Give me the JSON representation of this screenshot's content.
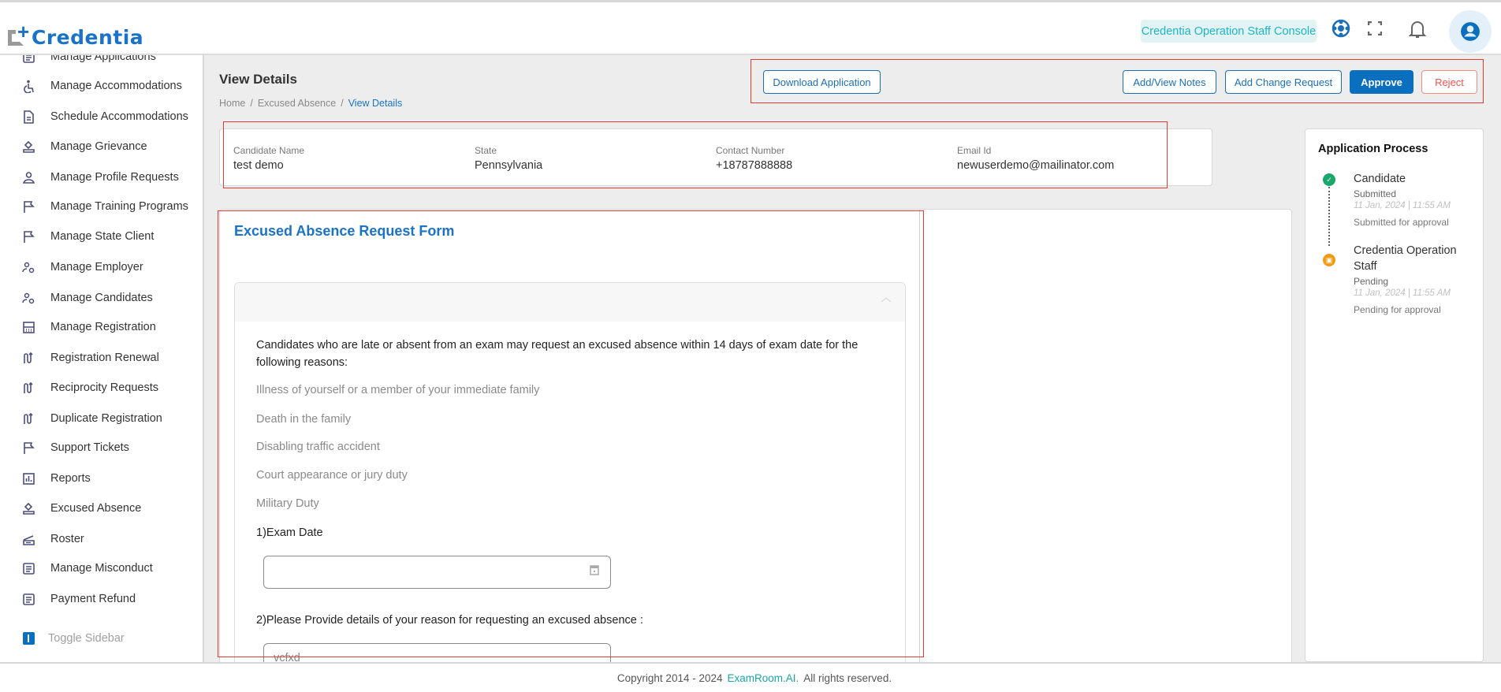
{
  "header": {
    "logo_text": "Credentia",
    "console_badge": "Credentia Operation Staff Console",
    "icons": [
      "support-icon",
      "fullscreen-icon",
      "bell-icon",
      "account-icon"
    ]
  },
  "sidebar": {
    "items": [
      {
        "label": "Manage Applications",
        "icon": "document-icon"
      },
      {
        "label": "Manage Accommodations",
        "icon": "accessible-icon"
      },
      {
        "label": "Schedule Accommodations",
        "icon": "file-icon"
      },
      {
        "label": "Manage Grievance",
        "icon": "stamp-icon"
      },
      {
        "label": "Manage Profile Requests",
        "icon": "person-icon"
      },
      {
        "label": "Manage Training Programs",
        "icon": "flag-icon"
      },
      {
        "label": "Manage State Client",
        "icon": "flag-icon"
      },
      {
        "label": "Manage Employer",
        "icon": "people-gear-icon"
      },
      {
        "label": "Manage Candidates",
        "icon": "people-gear-icon"
      },
      {
        "label": "Manage Registration",
        "icon": "grid-icon"
      },
      {
        "label": "Registration Renewal",
        "icon": "renew-icon"
      },
      {
        "label": "Reciprocity Requests",
        "icon": "renew-icon"
      },
      {
        "label": "Duplicate Registration",
        "icon": "renew-icon"
      },
      {
        "label": "Support Tickets",
        "icon": "flag-icon"
      },
      {
        "label": "Reports",
        "icon": "chart-icon"
      },
      {
        "label": "Excused Absence",
        "icon": "stamp-icon"
      },
      {
        "label": "Roster",
        "icon": "roster-icon"
      },
      {
        "label": "Manage Misconduct",
        "icon": "document-icon"
      },
      {
        "label": "Payment Refund",
        "icon": "document-icon"
      }
    ],
    "toggle_label": "Toggle Sidebar"
  },
  "page": {
    "title": "View Details",
    "breadcrumb": [
      "Home",
      "Excused Absence",
      "View Details"
    ],
    "separator": "/"
  },
  "actions": {
    "download": "Download Application",
    "notes": "Add/View Notes",
    "change_request": "Add Change Request",
    "approve": "Approve",
    "reject": "Reject"
  },
  "candidate": [
    {
      "label": "Candidate Name",
      "value": "test demo"
    },
    {
      "label": "State",
      "value": "Pennsylvania"
    },
    {
      "label": "Contact Number",
      "value": "+18787888888"
    },
    {
      "label": "Email Id",
      "value": "newuserdemo@mailinator.com"
    }
  ],
  "form": {
    "title": "Excused Absence Request Form",
    "intro": "Candidates who are late or absent from an exam may request an excused absence within 14 days of exam date for the following reasons:",
    "reasons": [
      "Illness of yourself or a member of your immediate family",
      "Death in the family",
      "Disabling traffic accident",
      "Court appearance or jury duty",
      "Military Duty"
    ],
    "q1": "1)Exam Date",
    "q1_value": "",
    "q2": "2)Please Provide details of your reason for requesting an excused absence :",
    "q2_value": "vcfxd"
  },
  "process": {
    "title": "Application Process",
    "steps": [
      {
        "name": "Candidate",
        "status": "Submitted",
        "date": "11 Jan, 2024 | 11:55 AM",
        "note": "Submitted for approval",
        "color": "#1aa86a"
      },
      {
        "name": "Credentia Operation Staff",
        "status": "Pending",
        "date": "11 Jan, 2024 | 11:55 AM",
        "note": "Pending for approval",
        "color": "#f29a12"
      }
    ]
  },
  "footer": {
    "copyright": "Copyright 2014 - 2024",
    "link": "ExamRoom.AI.",
    "rights": "All rights reserved."
  }
}
